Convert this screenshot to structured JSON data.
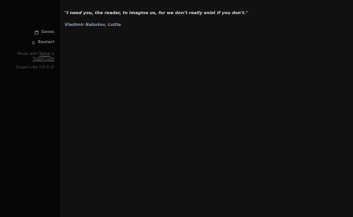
{
  "sidebar": {
    "menu": [
      {
        "label": "Saves",
        "icon": "save-icon"
      },
      {
        "label": "Restart",
        "icon": "restart-icon"
      }
    ],
    "credits": {
      "prefix": "Made with ",
      "twine_link": "Twine",
      "joiner": " & ",
      "sugarcube_link": "SugarCube"
    },
    "version": "SugarCube (v2.6.2)"
  },
  "passage": {
    "quote": "\"I need you, the reader, to imagine us, for we don't really exist if you don't.\"",
    "attribution": "Vladimir Nabokov, Lolita"
  },
  "colors": {
    "sidebar_bg": "#060606",
    "main_bg": "#111111",
    "quote_text": "#d6d6d6",
    "attribution_text": "#8f9aa8"
  }
}
